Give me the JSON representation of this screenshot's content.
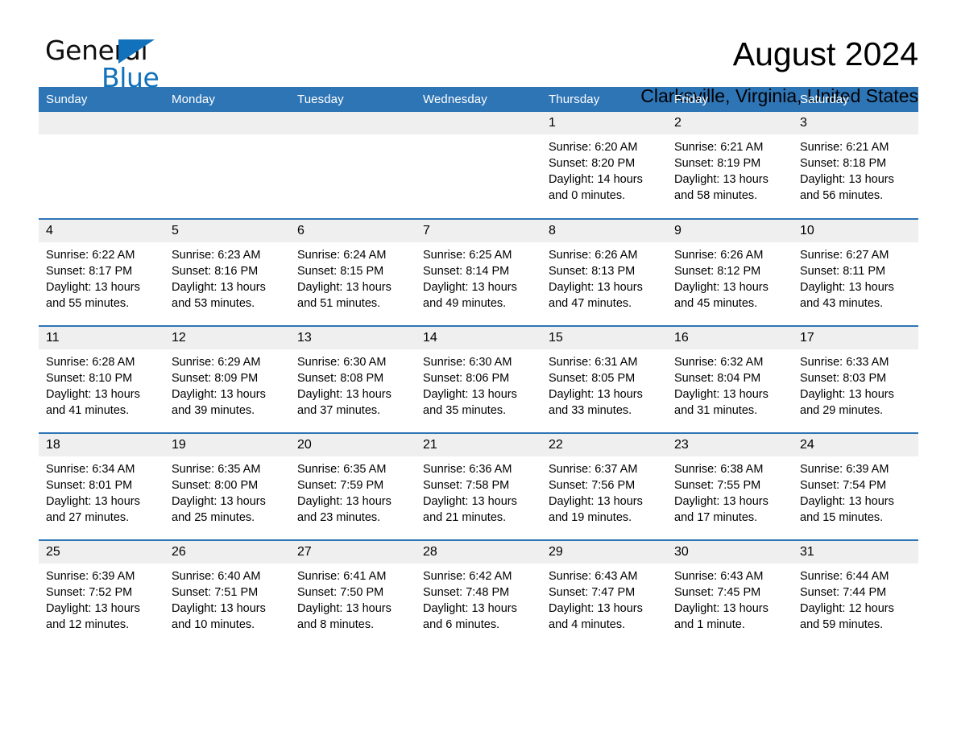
{
  "logo": {
    "word_top": "General",
    "word_bottom": "Blue",
    "accent_color": "#1172bb"
  },
  "header": {
    "title": "August 2024",
    "subtitle": "Clarksville, Virginia, United States"
  },
  "theme": {
    "header_blue": "#2e75b6",
    "date_band_gray": "#efefef",
    "text_black": "#000000"
  },
  "calendar": {
    "day_headers": [
      "Sunday",
      "Monday",
      "Tuesday",
      "Wednesday",
      "Thursday",
      "Friday",
      "Saturday"
    ],
    "weeks": [
      [
        {
          "empty": true
        },
        {
          "empty": true
        },
        {
          "empty": true
        },
        {
          "empty": true
        },
        {
          "day": "1",
          "sunrise": "Sunrise: 6:20 AM",
          "sunset": "Sunset: 8:20 PM",
          "daylight": "Daylight: 14 hours and 0 minutes."
        },
        {
          "day": "2",
          "sunrise": "Sunrise: 6:21 AM",
          "sunset": "Sunset: 8:19 PM",
          "daylight": "Daylight: 13 hours and 58 minutes."
        },
        {
          "day": "3",
          "sunrise": "Sunrise: 6:21 AM",
          "sunset": "Sunset: 8:18 PM",
          "daylight": "Daylight: 13 hours and 56 minutes."
        }
      ],
      [
        {
          "day": "4",
          "sunrise": "Sunrise: 6:22 AM",
          "sunset": "Sunset: 8:17 PM",
          "daylight": "Daylight: 13 hours and 55 minutes."
        },
        {
          "day": "5",
          "sunrise": "Sunrise: 6:23 AM",
          "sunset": "Sunset: 8:16 PM",
          "daylight": "Daylight: 13 hours and 53 minutes."
        },
        {
          "day": "6",
          "sunrise": "Sunrise: 6:24 AM",
          "sunset": "Sunset: 8:15 PM",
          "daylight": "Daylight: 13 hours and 51 minutes."
        },
        {
          "day": "7",
          "sunrise": "Sunrise: 6:25 AM",
          "sunset": "Sunset: 8:14 PM",
          "daylight": "Daylight: 13 hours and 49 minutes."
        },
        {
          "day": "8",
          "sunrise": "Sunrise: 6:26 AM",
          "sunset": "Sunset: 8:13 PM",
          "daylight": "Daylight: 13 hours and 47 minutes."
        },
        {
          "day": "9",
          "sunrise": "Sunrise: 6:26 AM",
          "sunset": "Sunset: 8:12 PM",
          "daylight": "Daylight: 13 hours and 45 minutes."
        },
        {
          "day": "10",
          "sunrise": "Sunrise: 6:27 AM",
          "sunset": "Sunset: 8:11 PM",
          "daylight": "Daylight: 13 hours and 43 minutes."
        }
      ],
      [
        {
          "day": "11",
          "sunrise": "Sunrise: 6:28 AM",
          "sunset": "Sunset: 8:10 PM",
          "daylight": "Daylight: 13 hours and 41 minutes."
        },
        {
          "day": "12",
          "sunrise": "Sunrise: 6:29 AM",
          "sunset": "Sunset: 8:09 PM",
          "daylight": "Daylight: 13 hours and 39 minutes."
        },
        {
          "day": "13",
          "sunrise": "Sunrise: 6:30 AM",
          "sunset": "Sunset: 8:08 PM",
          "daylight": "Daylight: 13 hours and 37 minutes."
        },
        {
          "day": "14",
          "sunrise": "Sunrise: 6:30 AM",
          "sunset": "Sunset: 8:06 PM",
          "daylight": "Daylight: 13 hours and 35 minutes."
        },
        {
          "day": "15",
          "sunrise": "Sunrise: 6:31 AM",
          "sunset": "Sunset: 8:05 PM",
          "daylight": "Daylight: 13 hours and 33 minutes."
        },
        {
          "day": "16",
          "sunrise": "Sunrise: 6:32 AM",
          "sunset": "Sunset: 8:04 PM",
          "daylight": "Daylight: 13 hours and 31 minutes."
        },
        {
          "day": "17",
          "sunrise": "Sunrise: 6:33 AM",
          "sunset": "Sunset: 8:03 PM",
          "daylight": "Daylight: 13 hours and 29 minutes."
        }
      ],
      [
        {
          "day": "18",
          "sunrise": "Sunrise: 6:34 AM",
          "sunset": "Sunset: 8:01 PM",
          "daylight": "Daylight: 13 hours and 27 minutes."
        },
        {
          "day": "19",
          "sunrise": "Sunrise: 6:35 AM",
          "sunset": "Sunset: 8:00 PM",
          "daylight": "Daylight: 13 hours and 25 minutes."
        },
        {
          "day": "20",
          "sunrise": "Sunrise: 6:35 AM",
          "sunset": "Sunset: 7:59 PM",
          "daylight": "Daylight: 13 hours and 23 minutes."
        },
        {
          "day": "21",
          "sunrise": "Sunrise: 6:36 AM",
          "sunset": "Sunset: 7:58 PM",
          "daylight": "Daylight: 13 hours and 21 minutes."
        },
        {
          "day": "22",
          "sunrise": "Sunrise: 6:37 AM",
          "sunset": "Sunset: 7:56 PM",
          "daylight": "Daylight: 13 hours and 19 minutes."
        },
        {
          "day": "23",
          "sunrise": "Sunrise: 6:38 AM",
          "sunset": "Sunset: 7:55 PM",
          "daylight": "Daylight: 13 hours and 17 minutes."
        },
        {
          "day": "24",
          "sunrise": "Sunrise: 6:39 AM",
          "sunset": "Sunset: 7:54 PM",
          "daylight": "Daylight: 13 hours and 15 minutes."
        }
      ],
      [
        {
          "day": "25",
          "sunrise": "Sunrise: 6:39 AM",
          "sunset": "Sunset: 7:52 PM",
          "daylight": "Daylight: 13 hours and 12 minutes."
        },
        {
          "day": "26",
          "sunrise": "Sunrise: 6:40 AM",
          "sunset": "Sunset: 7:51 PM",
          "daylight": "Daylight: 13 hours and 10 minutes."
        },
        {
          "day": "27",
          "sunrise": "Sunrise: 6:41 AM",
          "sunset": "Sunset: 7:50 PM",
          "daylight": "Daylight: 13 hours and 8 minutes."
        },
        {
          "day": "28",
          "sunrise": "Sunrise: 6:42 AM",
          "sunset": "Sunset: 7:48 PM",
          "daylight": "Daylight: 13 hours and 6 minutes."
        },
        {
          "day": "29",
          "sunrise": "Sunrise: 6:43 AM",
          "sunset": "Sunset: 7:47 PM",
          "daylight": "Daylight: 13 hours and 4 minutes."
        },
        {
          "day": "30",
          "sunrise": "Sunrise: 6:43 AM",
          "sunset": "Sunset: 7:45 PM",
          "daylight": "Daylight: 13 hours and 1 minute."
        },
        {
          "day": "31",
          "sunrise": "Sunrise: 6:44 AM",
          "sunset": "Sunset: 7:44 PM",
          "daylight": "Daylight: 12 hours and 59 minutes."
        }
      ]
    ]
  }
}
